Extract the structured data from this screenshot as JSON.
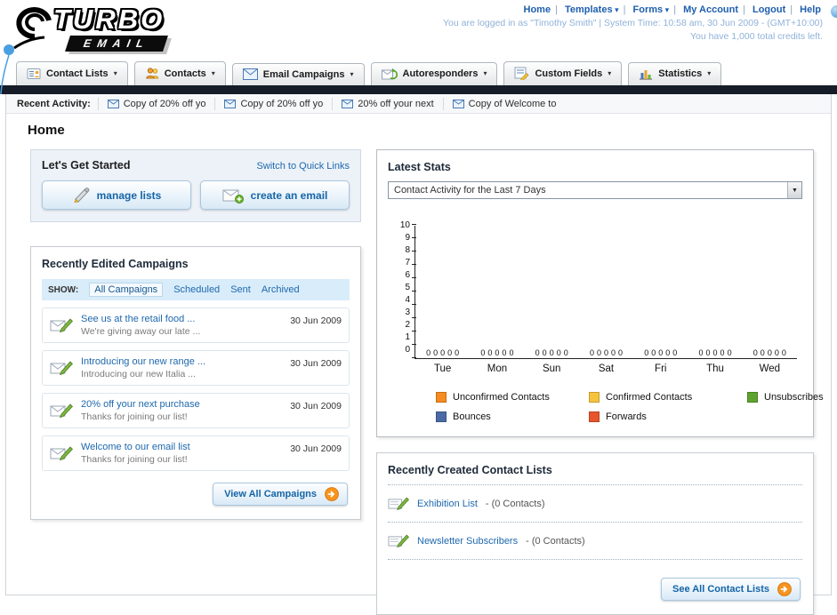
{
  "header": {
    "logo_title": "TURBO",
    "logo_subtitle": "EMAIL",
    "top_links": [
      {
        "label": "Home"
      },
      {
        "label": "Templates",
        "has_menu": true
      },
      {
        "label": "Forms",
        "has_menu": true
      },
      {
        "label": "My Account"
      },
      {
        "label": "Logout"
      },
      {
        "label": "Help"
      }
    ],
    "login_info": "You are logged in as \"Timothy Smith\" | System Time: 10:58 am, 30 Jun 2009 - (GMT+10:00)",
    "credits_info": "You have 1,000 total credits left."
  },
  "nav": {
    "tabs": [
      {
        "label": "Contact Lists",
        "icon": "contact-lists-icon"
      },
      {
        "label": "Contacts",
        "icon": "contacts-icon"
      },
      {
        "label": "Email Campaigns",
        "icon": "email-campaigns-icon"
      },
      {
        "label": "Autoresponders",
        "icon": "autoresponders-icon"
      },
      {
        "label": "Custom Fields",
        "icon": "custom-fields-icon"
      },
      {
        "label": "Statistics",
        "icon": "statistics-icon"
      }
    ]
  },
  "recent_activity": {
    "label": "Recent Activity:",
    "items": [
      {
        "label": "Copy of 20% off yo"
      },
      {
        "label": "Copy of 20% off yo"
      },
      {
        "label": "20% off your next"
      },
      {
        "label": "Copy of Welcome to"
      }
    ]
  },
  "page_title": "Home",
  "get_started": {
    "title": "Let's Get Started",
    "switch_link": "Switch to Quick Links",
    "manage_lists_label": "manage lists",
    "create_email_label": "create an email"
  },
  "campaigns": {
    "title": "Recently Edited Campaigns",
    "show_label": "SHOW:",
    "filters": [
      {
        "label": "All Campaigns",
        "selected": true
      },
      {
        "label": "Scheduled"
      },
      {
        "label": "Sent"
      },
      {
        "label": "Archived"
      }
    ],
    "items": [
      {
        "title": "See us at the retail food ...",
        "subtitle": "We're giving away our late ...",
        "date": "30 Jun 2009"
      },
      {
        "title": "Introducing our new range ...",
        "subtitle": "Introducing our new Italia ...",
        "date": "30 Jun 2009"
      },
      {
        "title": "20% off your next purchase",
        "subtitle": "Thanks for joining our list!",
        "date": "30 Jun 2009"
      },
      {
        "title": "Welcome to our email list",
        "subtitle": "Thanks for joining our list!",
        "date": "30 Jun 2009"
      }
    ],
    "view_all_label": "View All Campaigns"
  },
  "stats": {
    "title": "Latest Stats",
    "dropdown_value": "Contact Activity for the Last 7 Days",
    "chart_data": {
      "type": "bar",
      "title": "Contact Activity for the Last 7 Days",
      "categories": [
        "Tue",
        "Mon",
        "Sun",
        "Sat",
        "Fri",
        "Thu",
        "Wed"
      ],
      "series": [
        {
          "name": "Unconfirmed Contacts",
          "color": "#f68b1f",
          "values": [
            0,
            0,
            0,
            0,
            0,
            0,
            0
          ]
        },
        {
          "name": "Confirmed Contacts",
          "color": "#f6c33c",
          "values": [
            0,
            0,
            0,
            0,
            0,
            0,
            0
          ]
        },
        {
          "name": "Unsubscribes",
          "color": "#5da32e",
          "values": [
            0,
            0,
            0,
            0,
            0,
            0,
            0
          ]
        },
        {
          "name": "Bounces",
          "color": "#4a69a5",
          "values": [
            0,
            0,
            0,
            0,
            0,
            0,
            0
          ]
        },
        {
          "name": "Forwards",
          "color": "#e8542b",
          "values": [
            0,
            0,
            0,
            0,
            0,
            0,
            0
          ]
        }
      ],
      "ylim": [
        0,
        10
      ],
      "grid": false,
      "legend_position": "bottom"
    }
  },
  "contact_lists": {
    "title": "Recently Created Contact Lists",
    "items": [
      {
        "name": "Exhibition List",
        "detail": "- (0 Contacts)"
      },
      {
        "name": "Newsletter Subscribers",
        "detail": "- (0 Contacts)"
      }
    ],
    "see_all_label": "See All Contact Lists"
  }
}
